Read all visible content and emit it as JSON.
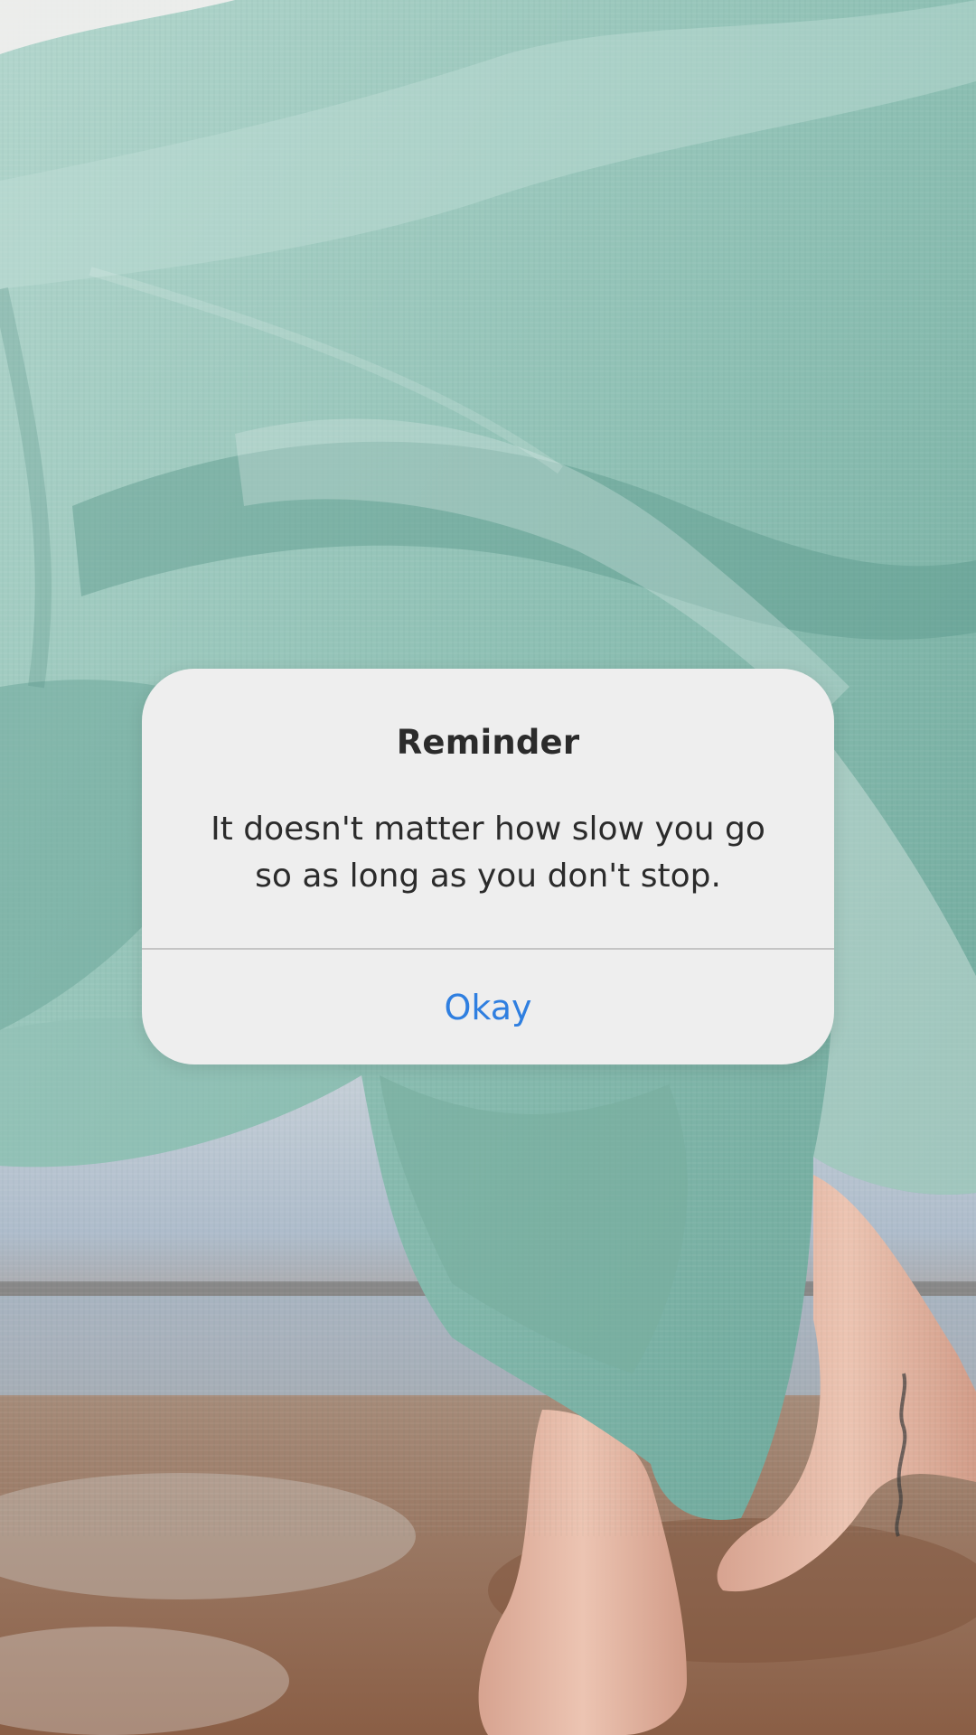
{
  "background": {
    "description_icon": "photo-dress-feet",
    "colors": {
      "fabric_light": "#a9d0c7",
      "fabric_mid": "#86b9ad",
      "fabric_dark": "#5e9a8d",
      "sky": "#d9e2ea",
      "rooftop": "#b9c6d2",
      "ground_rust": "#9a6e55",
      "skin": "#e2b4a0"
    }
  },
  "dialog": {
    "title": "Reminder",
    "message_line1": "It doesn't matter how slow you go",
    "message_line2": "so as long as you don't stop.",
    "button_label": "Okay",
    "colors": {
      "background": "#eeeeee",
      "text": "#2b2b2b",
      "button_text": "#2f7fe0",
      "divider": "#c4c4c4"
    }
  }
}
